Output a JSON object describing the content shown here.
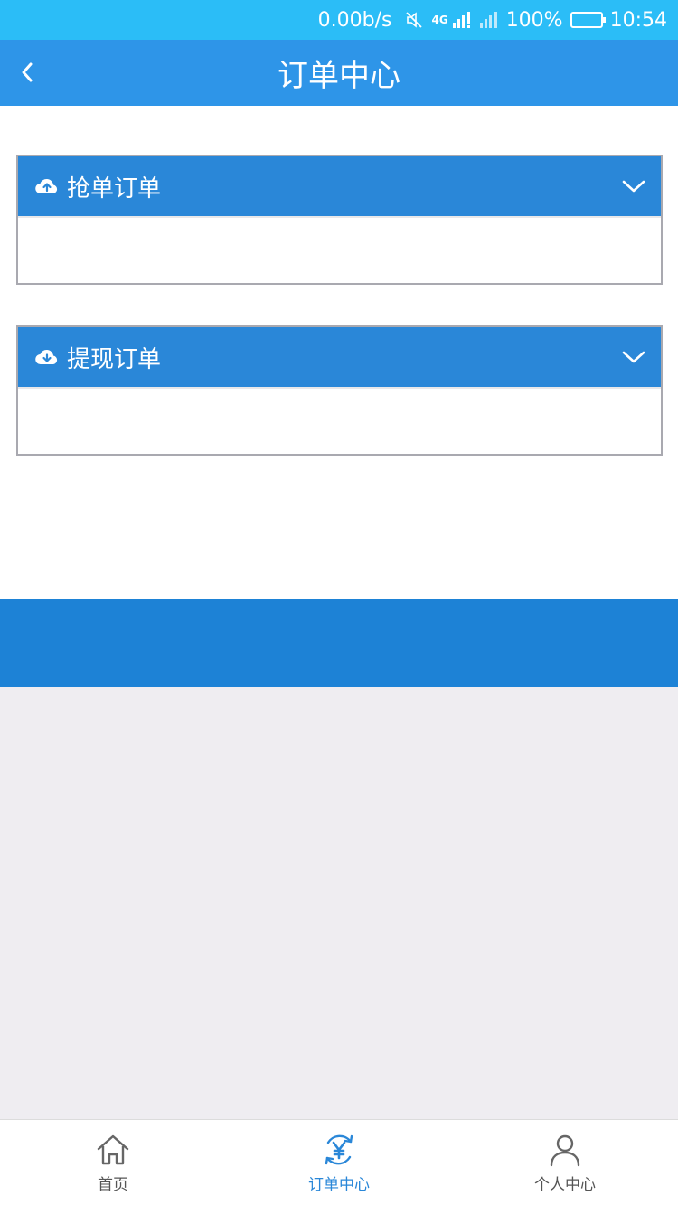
{
  "status_bar": {
    "speed": "0.00b/s",
    "network": "4G",
    "battery": "100%",
    "time": "10:54"
  },
  "nav": {
    "title": "订单中心",
    "back_icon": "chevron-left-icon"
  },
  "panels": [
    {
      "label": "抢单订单",
      "icon": "cloud-upload-icon",
      "toggle_icon": "chevron-down-icon"
    },
    {
      "label": "提现订单",
      "icon": "cloud-download-icon",
      "toggle_icon": "chevron-down-icon"
    }
  ],
  "tabs": [
    {
      "label": "首页",
      "icon": "home-icon",
      "active": false
    },
    {
      "label": "订单中心",
      "icon": "yuan-refresh-icon",
      "active": true
    },
    {
      "label": "个人中心",
      "icon": "user-icon",
      "active": false
    }
  ],
  "colors": {
    "status_bar": "#2bbdf7",
    "nav_bar": "#2e95e8",
    "panel_header": "#2a87d8",
    "blue_band": "#1d82d6",
    "page_bg": "#efedf1",
    "active_tab": "#2a87d8"
  }
}
